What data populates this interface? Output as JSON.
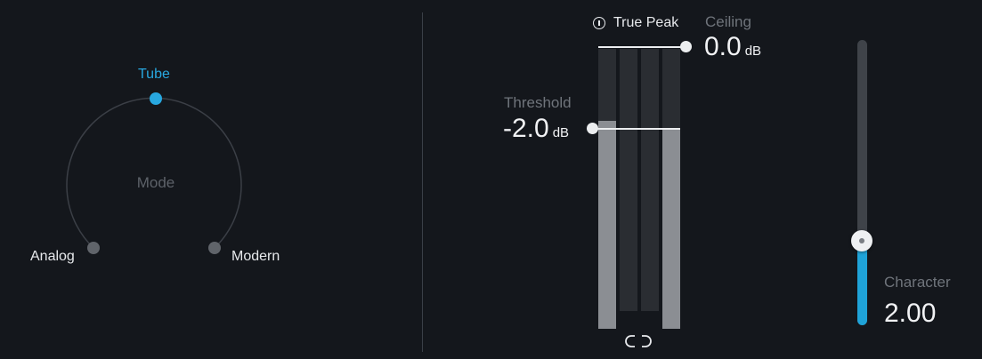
{
  "mode": {
    "label": "Mode",
    "options": {
      "tube": "Tube",
      "analog": "Analog",
      "modern": "Modern"
    },
    "selected": "Tube"
  },
  "true_peak": {
    "label": "True Peak"
  },
  "ceiling": {
    "label": "Ceiling",
    "value": "0.0",
    "unit": "dB"
  },
  "threshold": {
    "label": "Threshold",
    "value": "-2.0",
    "unit": "dB"
  },
  "character": {
    "label": "Character",
    "value": "2.00"
  },
  "colors": {
    "accent": "#28a8e0",
    "background": "#14171c"
  },
  "icons": {
    "true_peak": "info-circle-icon",
    "link": "link-icon"
  }
}
